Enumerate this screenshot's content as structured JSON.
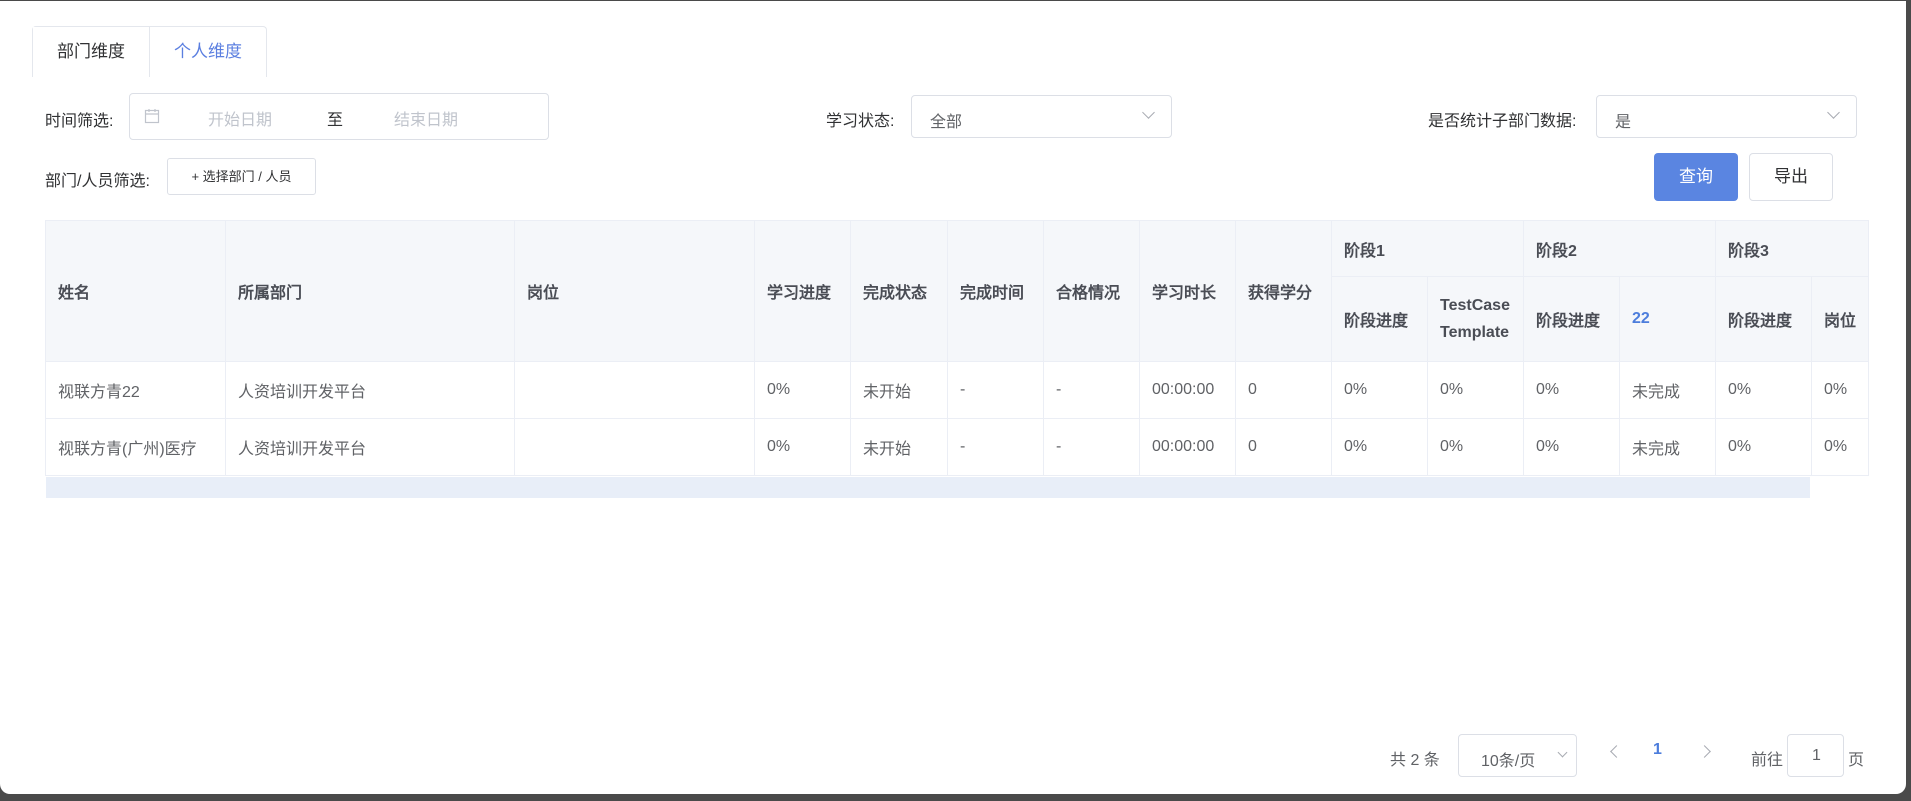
{
  "tabs": [
    "部门维度",
    "个人维度"
  ],
  "filters": {
    "time_label": "时间筛选:",
    "start_placeholder": "开始日期",
    "range_sep": "至",
    "end_placeholder": "结束日期",
    "status_label": "学习状态:",
    "status_value": "全部",
    "sub_dept_label": "是否统计子部门数据:",
    "sub_dept_value": "是",
    "dept_label": "部门/人员筛选:",
    "select_btn": "+ 选择部门 / 人员"
  },
  "buttons": {
    "query": "查询",
    "export": "导出"
  },
  "table": {
    "headers": [
      "姓名",
      "所属部门",
      "岗位",
      "学习进度",
      "完成状态",
      "完成时间",
      "合格情况",
      "学习时长",
      "获得学分"
    ],
    "groups": [
      "阶段1",
      "阶段2",
      "阶段3"
    ],
    "subheaders": [
      "阶段进度",
      "TestCase Template",
      "阶段进度",
      "22",
      "阶段进度",
      "岗位"
    ],
    "rows": [
      [
        "视联方青22",
        "人资培训开发平台",
        "",
        "0%",
        "未开始",
        "-",
        "-",
        "00:00:00",
        "0",
        "0%",
        "0%",
        "0%",
        "未完成",
        "0%",
        "0%"
      ],
      [
        "视联方青(广州)医疗",
        "人资培训开发平台",
        "",
        "0%",
        "未开始",
        "-",
        "-",
        "00:00:00",
        "0",
        "0%",
        "0%",
        "0%",
        "未完成",
        "0%",
        "0%"
      ]
    ]
  },
  "pagination": {
    "total": "共 2 条",
    "page_size": "10条/页",
    "current": "1",
    "goto_prefix": "前往",
    "goto_value": "1",
    "goto_suffix": "页"
  },
  "colors": {
    "primary": "#5a85e1",
    "link": "#4c7ddc"
  },
  "icons": [
    "calendar-icon",
    "chevron-down-icon",
    "chevron-left-icon",
    "chevron-right-icon"
  ]
}
